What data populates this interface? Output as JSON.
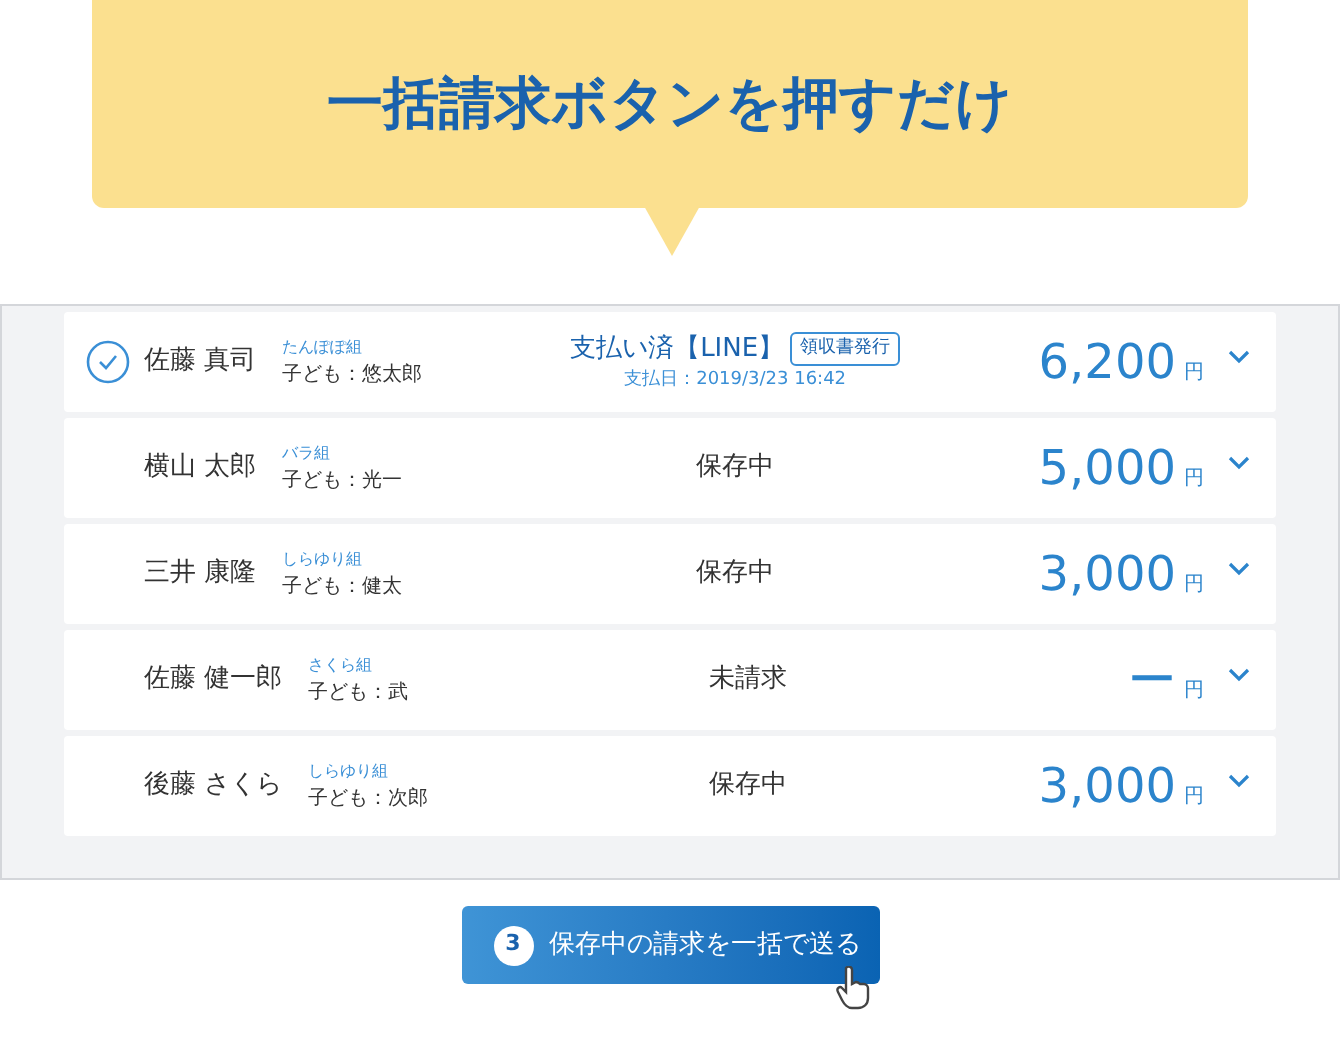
{
  "headline": "一括請求ボタンを押すだけ",
  "rows": [
    {
      "name": "佐藤 真司",
      "group": "たんぽぽ組",
      "child": "子ども：悠太郎",
      "checked": true,
      "kind": "paid",
      "status": "支払い済【LINE】",
      "receipt": "領収書発行",
      "paid_date": "支払日：2019/3/23 16:42",
      "amount": "6,200",
      "unit": "円"
    },
    {
      "name": "横山 太郎",
      "group": "バラ組",
      "child": "子ども：光一",
      "checked": false,
      "kind": "plain",
      "status": "保存中",
      "amount": "5,000",
      "unit": "円"
    },
    {
      "name": "三井 康隆",
      "group": "しらゆり組",
      "child": "子ども：健太",
      "checked": false,
      "kind": "plain",
      "status": "保存中",
      "amount": "3,000",
      "unit": "円"
    },
    {
      "name": "佐藤 健一郎",
      "group": "さくら組",
      "child": "子ども：武",
      "checked": false,
      "kind": "plain",
      "status": "未請求",
      "amount": "ー",
      "unit": "円"
    },
    {
      "name": "後藤 さくら",
      "group": "しらゆり組",
      "child": "子ども：次郎",
      "checked": false,
      "kind": "plain",
      "status": "保存中",
      "amount": "3,000",
      "unit": "円"
    }
  ],
  "send_button": {
    "step": "3",
    "label": "保存中の請求を一括で送る"
  }
}
